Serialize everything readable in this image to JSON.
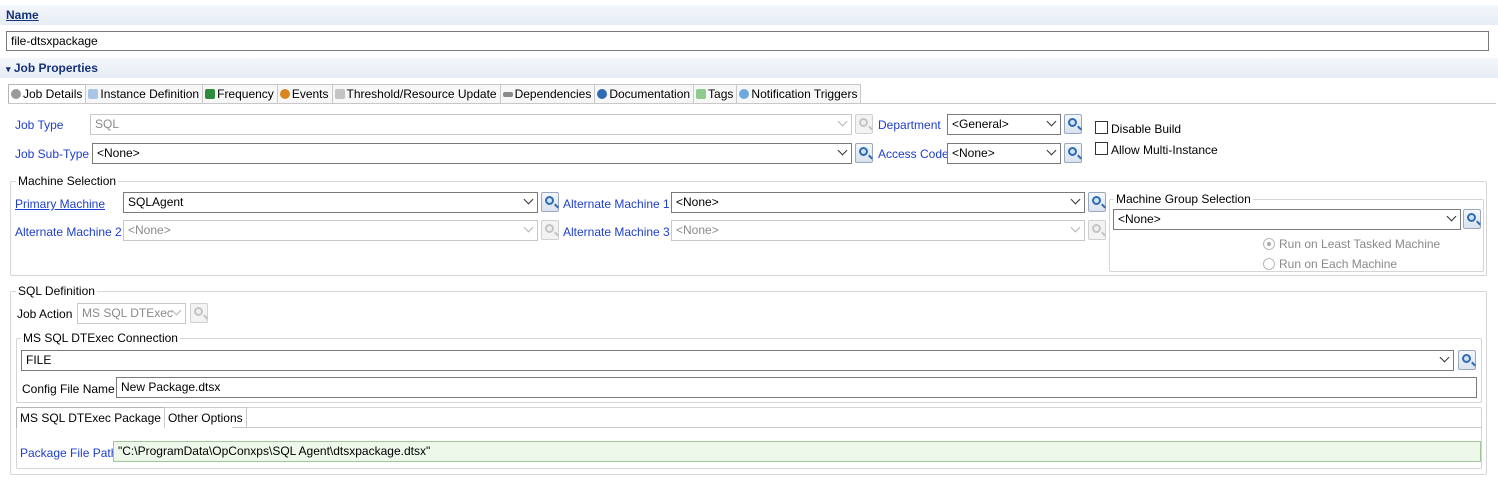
{
  "name_section": {
    "title": "Name",
    "value": "file-dtsxpackage"
  },
  "job_properties": {
    "title": "Job Properties"
  },
  "tabs": [
    {
      "label": "Job Details",
      "icon": "gear-icon",
      "color": "#7d7d7d"
    },
    {
      "label": "Instance Definition",
      "icon": "tag-icon",
      "color": "#8fb3d9"
    },
    {
      "label": "Frequency",
      "icon": "calendar-plus-icon",
      "color": "#2e8b3c"
    },
    {
      "label": "Events",
      "icon": "alert-icon",
      "color": "#d9861e"
    },
    {
      "label": "Threshold/Resource Update",
      "icon": "threshold-icon",
      "color": "#b0b0b0"
    },
    {
      "label": "Dependencies",
      "icon": "link-icon",
      "color": "#7a7a7a"
    },
    {
      "label": "Documentation",
      "icon": "help-icon",
      "color": "#2f6bb3"
    },
    {
      "label": "Tags",
      "icon": "tag-icon",
      "color": "#6fb36f"
    },
    {
      "label": "Notification Triggers",
      "icon": "notification-icon",
      "color": "#4a8ed0"
    }
  ],
  "job_details": {
    "job_type_label": "Job Type",
    "job_type_value": "SQL",
    "job_subtype_label": "Job Sub-Type",
    "job_subtype_value": "<None>",
    "department_label": "Department",
    "department_value": "<General>",
    "access_code_label": "Access Code",
    "access_code_value": "<None>",
    "disable_build_label": "Disable Build",
    "allow_multi_label": "Allow Multi-Instance"
  },
  "machine_selection": {
    "title": "Machine Selection",
    "primary_label": "Primary Machine",
    "primary_value": "SQLAgent",
    "alt1_label": "Alternate Machine 1",
    "alt1_value": "<None>",
    "alt2_label": "Alternate Machine 2",
    "alt2_value": "<None>",
    "alt3_label": "Alternate Machine 3",
    "alt3_value": "<None>",
    "group_title": "Machine Group Selection",
    "group_value": "<None>",
    "radio_least": "Run on Least Tasked Machine",
    "radio_each": "Run on Each Machine"
  },
  "sql_definition": {
    "title": "SQL Definition",
    "job_action_label": "Job Action",
    "job_action_value": "MS SQL DTExec",
    "connection_title": "MS SQL DTExec Connection",
    "connection_value": "FILE",
    "config_label": "Config File Name",
    "config_value": "New Package.dtsx",
    "subtabs": [
      "MS SQL DTExec Package",
      "Other Options"
    ],
    "package_path_label": "Package File Path",
    "package_path_value": "\"C:\\ProgramData\\OpConxps\\SQL Agent\\dtsxpackage.dtsx\""
  }
}
